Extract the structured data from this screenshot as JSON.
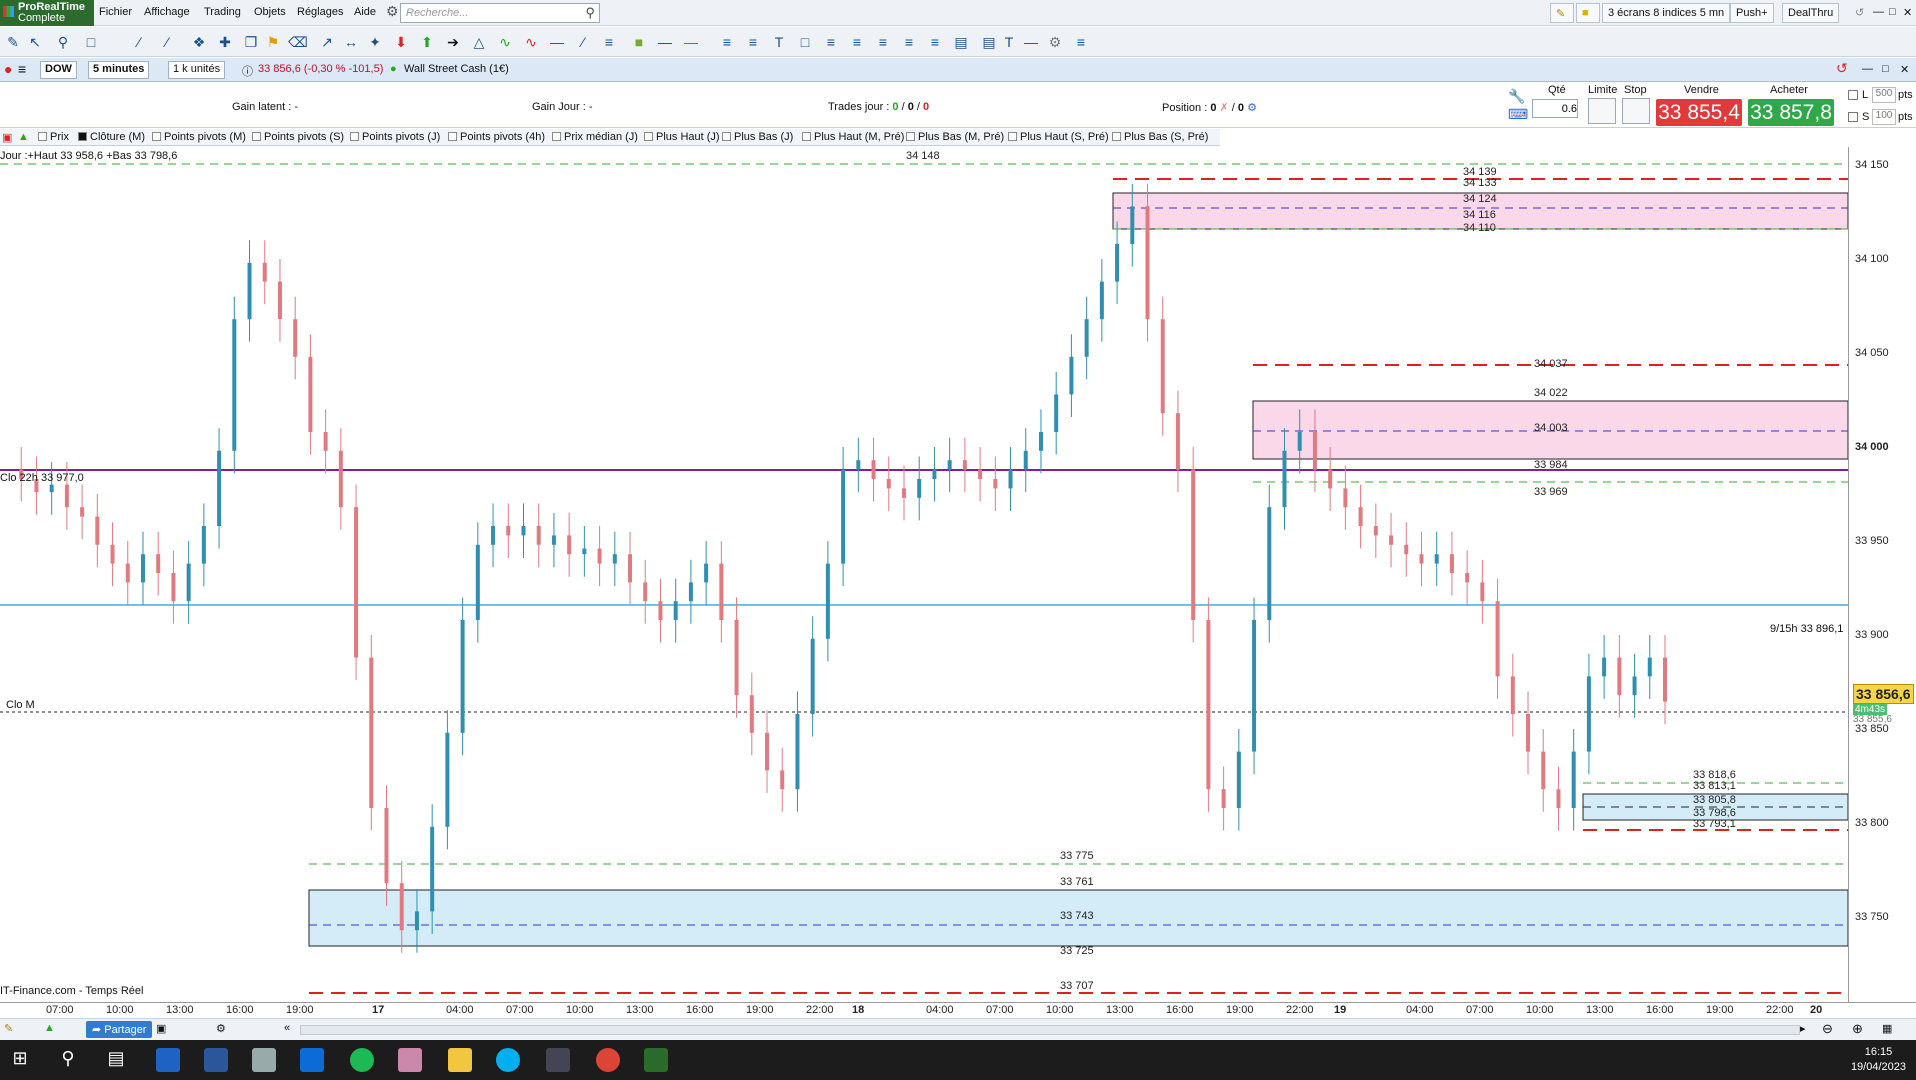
{
  "app": {
    "name": "ProRealTime",
    "edition": "Complete"
  },
  "menu": [
    "Fichier",
    "Affichage",
    "Trading",
    "Objets",
    "Réglages",
    "Aide"
  ],
  "search_placeholder": "Recherche...",
  "top_right": {
    "layout": "3 écrans 8 indices 5 mn",
    "push": "Push+",
    "dealthru": "DealThru"
  },
  "instrument": {
    "symbol": "DOW",
    "timeframe": "5 minutes",
    "units": "1 k unités",
    "price": "33 856,6 (-0,30 % -101,5)",
    "name": "Wall Street Cash (1€)"
  },
  "info": {
    "gain_latent": "Gain latent :  -",
    "gain_jour": "Gain Jour :  -",
    "trades_label": "Trades jour :",
    "trades_a": "0",
    "trades_b": "0",
    "trades_c": "0",
    "position_label": "Position :",
    "position_a": "0",
    "position_b": "0"
  },
  "order": {
    "qty_label": "Qté",
    "qty": "0.6",
    "limit_label": "Limite",
    "stop_label": "Stop",
    "sell_label": "Vendre",
    "buy_label": "Acheter",
    "sell_price": "33 855,4",
    "buy_price": "33 857,8"
  },
  "side_panel": {
    "l_label": "L",
    "l_value": "500",
    "s_label": "S",
    "s_value": "100",
    "unit": "pts"
  },
  "indicators": [
    "Prix",
    "Clôture (M)",
    "Points pivots (M)",
    "Points pivots (S)",
    "Points pivots (J)",
    "Points pivots (4h)",
    "Prix médian (J)",
    "Plus Haut (J)",
    "Plus Bas (J)",
    "Plus Haut (M, Pré)",
    "Plus Bas (M, Pré)",
    "Plus Haut (S, Pré)",
    "Plus Bas (S, Pré)"
  ],
  "chart_labels": {
    "jour": "Jour :+Haut 33 958,6 +Bas 33 798,6",
    "clo22h": "Clo 22h 33 977,0",
    "clom": "Clo M",
    "vline": "9/15h 33 896,1",
    "footer": "IT-Finance.com - Temps Réel",
    "current_price": "33 856,6",
    "countdown": "4m43s",
    "countdown_under": "33 855,6"
  },
  "levels": {
    "l34148": "34 148",
    "l34139": "34 139",
    "l34133": "34 133",
    "l34124": "34 124",
    "l34116": "34 116",
    "l34110": "34 110",
    "l34037": "34 037",
    "l34022": "34 022",
    "l34003": "34 003",
    "l33984": "33 984",
    "l33969": "33 969",
    "l33818": "33 818,6",
    "l33813": "33 813,1",
    "l33805": "33 805,8",
    "l33798": "33 798,6",
    "l33793": "33 793,1",
    "l33775": "33 775",
    "l33761": "33 761",
    "l33743": "33 743",
    "l33725": "33 725",
    "l33707": "33 707"
  },
  "price_axis": [
    "34 150",
    "34 100",
    "34 050",
    "34 000",
    "33 950",
    "33 900",
    "33 850",
    "33 800",
    "33 750"
  ],
  "time_axis": [
    "07:00",
    "10:00",
    "13:00",
    "16:00",
    "19:00",
    "17",
    "04:00",
    "07:00",
    "10:00",
    "13:00",
    "16:00",
    "19:00",
    "22:00",
    "18",
    "04:00",
    "07:00",
    "10:00",
    "13:00",
    "16:00",
    "19:00",
    "22:00",
    "19",
    "04:00",
    "07:00",
    "10:00",
    "13:00",
    "16:00",
    "19:00",
    "22:00",
    "20"
  ],
  "status": {
    "share": "Partager"
  },
  "clock": {
    "time": "16:15",
    "date": "19/04/2023"
  },
  "chart_data": {
    "type": "candlestick",
    "instrument": "Wall Street Cash (1€)",
    "timeframe": "5 minutes",
    "price_ticks": [
      34150,
      34100,
      34050,
      34000,
      33950,
      33900,
      33850,
      33800,
      33750
    ],
    "closes": [
      33980,
      33975,
      33968,
      33972,
      33960,
      33955,
      33940,
      33930,
      33920,
      33935,
      33925,
      33910,
      33930,
      33950,
      33990,
      34060,
      34090,
      34080,
      34060,
      34040,
      34000,
      33990,
      33960,
      33880,
      33800,
      33760,
      33735,
      33745,
      33790,
      33840,
      33900,
      33940,
      33950,
      33945,
      33950,
      33940,
      33945,
      33935,
      33938,
      33930,
      33935,
      33920,
      33910,
      33900,
      33910,
      33920,
      33930,
      33900,
      33860,
      33840,
      33820,
      33810,
      33850,
      33890,
      33930,
      33980,
      33985,
      33975,
      33970,
      33965,
      33975,
      33980,
      33985,
      33980,
      33975,
      33970,
      33980,
      33990,
      34000,
      34020,
      34040,
      34060,
      34080,
      34100,
      34120,
      34060,
      34010,
      33980,
      33900,
      33810,
      33800,
      33830,
      33900,
      33960,
      33990,
      34000,
      33980,
      33970,
      33960,
      33950,
      33945,
      33940,
      33935,
      33930,
      33935,
      33925,
      33920,
      33910,
      33870,
      33850,
      33830,
      33810,
      33800,
      33830,
      33870,
      33880,
      33860,
      33870,
      33880,
      33856.6
    ],
    "levels": [
      34148,
      34139,
      34133,
      34124,
      34116,
      34110,
      34037,
      34022,
      34003,
      33984,
      33969,
      33977,
      33896.1,
      33818.6,
      33813.1,
      33805.8,
      33798.6,
      33793.1,
      33775,
      33761,
      33743,
      33725,
      33707
    ],
    "current": 33856.6
  }
}
